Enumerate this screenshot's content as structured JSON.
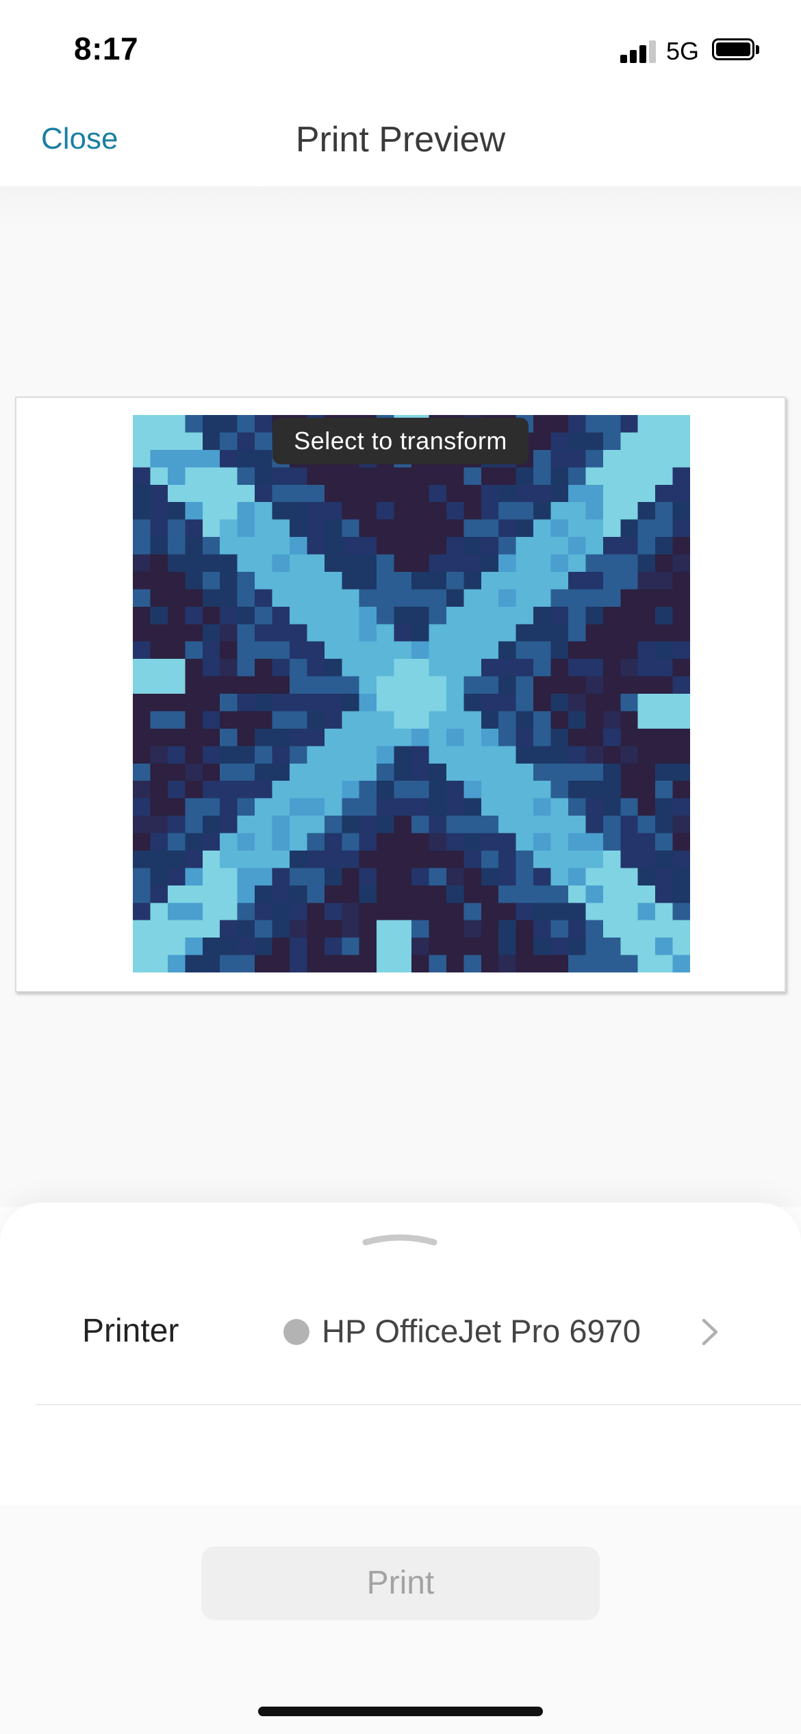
{
  "status_bar": {
    "time": "8:17",
    "network": "5G",
    "signal_bars_filled": 3,
    "signal_bars_total": 4,
    "icons": [
      "cellular-signal-icon",
      "battery-icon"
    ]
  },
  "nav": {
    "close_label": "Close",
    "title": "Print Preview"
  },
  "preview": {
    "tooltip": "Select to transform",
    "artwork_colors": {
      "background": "#2d2040",
      "light_cyan": "#7fd3e3",
      "mid_cyan": "#5bb6d8",
      "steel_blue": "#2b5d92",
      "navy": "#1d3866"
    }
  },
  "sheet": {
    "printer_label": "Printer",
    "printer_name": "HP OfficeJet Pro 6970",
    "printer_status_color": "#b3b3b3",
    "icons": [
      "grabber-icon",
      "chevron-right-icon"
    ]
  },
  "footer": {
    "print_label": "Print",
    "print_enabled": false
  },
  "colors": {
    "accent": "#1a7fa3",
    "disabled_text": "#a3a3a3",
    "disabled_bg": "#efefef"
  }
}
